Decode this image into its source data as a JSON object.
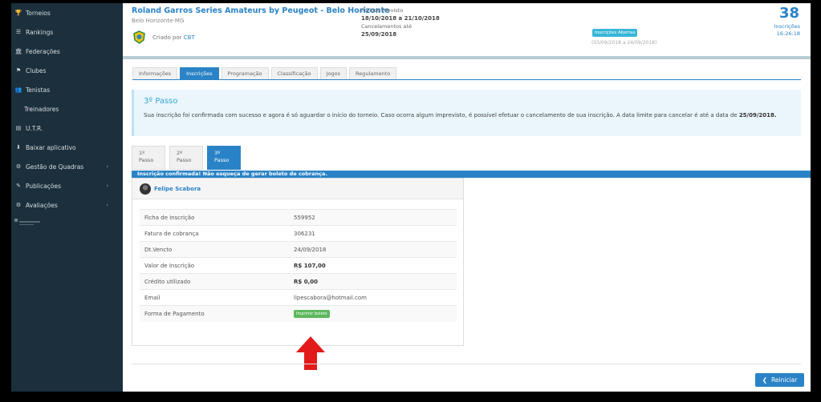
{
  "sidebar": {
    "items": [
      {
        "icon": "trophy-icon",
        "glyph": "🏆",
        "label": "Torneios"
      },
      {
        "icon": "list-icon",
        "glyph": "☰",
        "label": "Rankings"
      },
      {
        "icon": "institution-icon",
        "glyph": "🏛",
        "label": "Federações"
      },
      {
        "icon": "flag-icon",
        "glyph": "⚑",
        "label": "Clubes"
      },
      {
        "icon": "users-icon",
        "glyph": "👥",
        "label": "Tenistas"
      },
      {
        "icon": "",
        "glyph": "",
        "label": "Treinadores"
      },
      {
        "icon": "ranking-icon",
        "glyph": "▤",
        "label": "U.T.R."
      },
      {
        "icon": "download-icon",
        "glyph": "⬇",
        "label": "Baixar aplicativo"
      },
      {
        "icon": "gear-icon",
        "glyph": "⚙",
        "label": "Gestão de Quadras"
      },
      {
        "icon": "edit-icon",
        "glyph": "✎",
        "label": "Publicações"
      },
      {
        "icon": "gear-icon",
        "glyph": "⚙",
        "label": "Avaliações"
      }
    ]
  },
  "header": {
    "title": "Roland Garros Series Amateurs by Peugeot - Belo Horizonte",
    "city": "Belo Horizonte-MG",
    "created_by_prefix": "Criado por",
    "created_by": "CBT",
    "period_label": "Período Previsto",
    "period_value": "18/10/2018 a 21/10/2018",
    "cancel_label": "Cancelamentos até",
    "cancel_value": "25/09/2018",
    "badge": "Inscrições Abertas",
    "registration_period": "(03/09/2018 a 24/09/2018)",
    "count": "38",
    "count_label": "Inscrições",
    "countdown": "16:26:18"
  },
  "tabs": [
    "Informações",
    "Inscrições",
    "Programação",
    "Classificação",
    "Jogos",
    "Regulamento"
  ],
  "step_box": {
    "title": "3º Passo",
    "text": "Sua inscrição foi confirmada com sucesso e agora é só aguardar o início do torneio. Caso ocorra algum imprevisto, é possível efetuar o cancelamento de sua inscrição. A data limite para cancelar é até a data de ",
    "date": "25/09/2018."
  },
  "steps": [
    {
      "line1": "1º",
      "line2": "Passo"
    },
    {
      "line1": "2º",
      "line2": "Passo"
    },
    {
      "line1": "3º",
      "line2": "Passo"
    }
  ],
  "confirm_bar": "Inscrição confirmada! Não esqueça de gerar boleto de cobrança.",
  "user": {
    "name": "Felipe Scabora"
  },
  "details": [
    {
      "label": "Ficha de inscrição",
      "value": "559952"
    },
    {
      "label": "Fatura de cobrança",
      "value": "306231"
    },
    {
      "label": "Dt.Vencto",
      "value": "24/09/2018"
    },
    {
      "label": "Valor de Inscrição",
      "value": "R$ 107,00"
    },
    {
      "label": "Crédito utilizado",
      "value": "R$ 0,00"
    },
    {
      "label": "Email",
      "value": "lipescabora@hotmail.com"
    },
    {
      "label": "Forma de Pagamento",
      "value": "Imprimir boleto"
    }
  ],
  "reiniciar": "Reiniciar",
  "colors": {
    "primary": "#2a83c6",
    "sidebar": "#1b2f3c",
    "success": "#5cb85c",
    "arrow": "#e21a1a"
  }
}
